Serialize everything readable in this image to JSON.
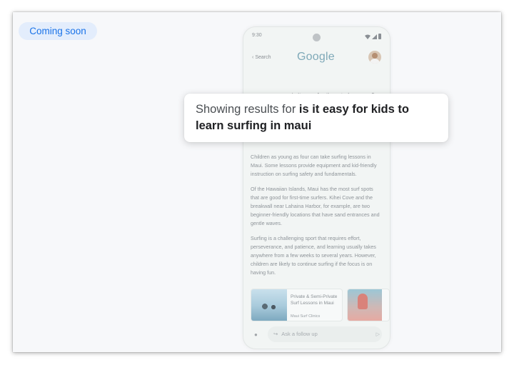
{
  "badge": {
    "label": "Coming soon"
  },
  "phone": {
    "status": {
      "time": "9:30"
    },
    "topbar": {
      "back_label": "Search",
      "logo": "Google"
    },
    "query": "is it easy for them to learn surfing",
    "answer_paragraphs": [
      "Children as young as four can take surfing lessons in Maui. Some lessons provide equipment and kid-friendly instruction on surfing safety and fundamentals.",
      "Of the Hawaiian Islands, Maui has the most surf spots that are good for first-time surfers. Kihei Cove and the breakwall near Lahaina Harbor, for example, are two beginner-friendly locations that have sand entrances and gentle waves.",
      "Surfing is a challenging sport that requires effort, perseverance, and patience, and learning usually takes anywhere from a few weeks to several years. However, children are likely to continue surfing if the focus is on having fun."
    ],
    "cards": [
      {
        "title": "Private & Semi-Private Surf Lessons in Maui",
        "source": "Maui Surf Clinics"
      }
    ],
    "followup_placeholder": "Ask a follow up"
  },
  "popup": {
    "prefix": "Showing results for ",
    "bold_query": "is it easy for kids to learn surfing in maui"
  },
  "colors": {
    "accent": "#1a73e8",
    "badge_bg": "#e3edfc"
  }
}
